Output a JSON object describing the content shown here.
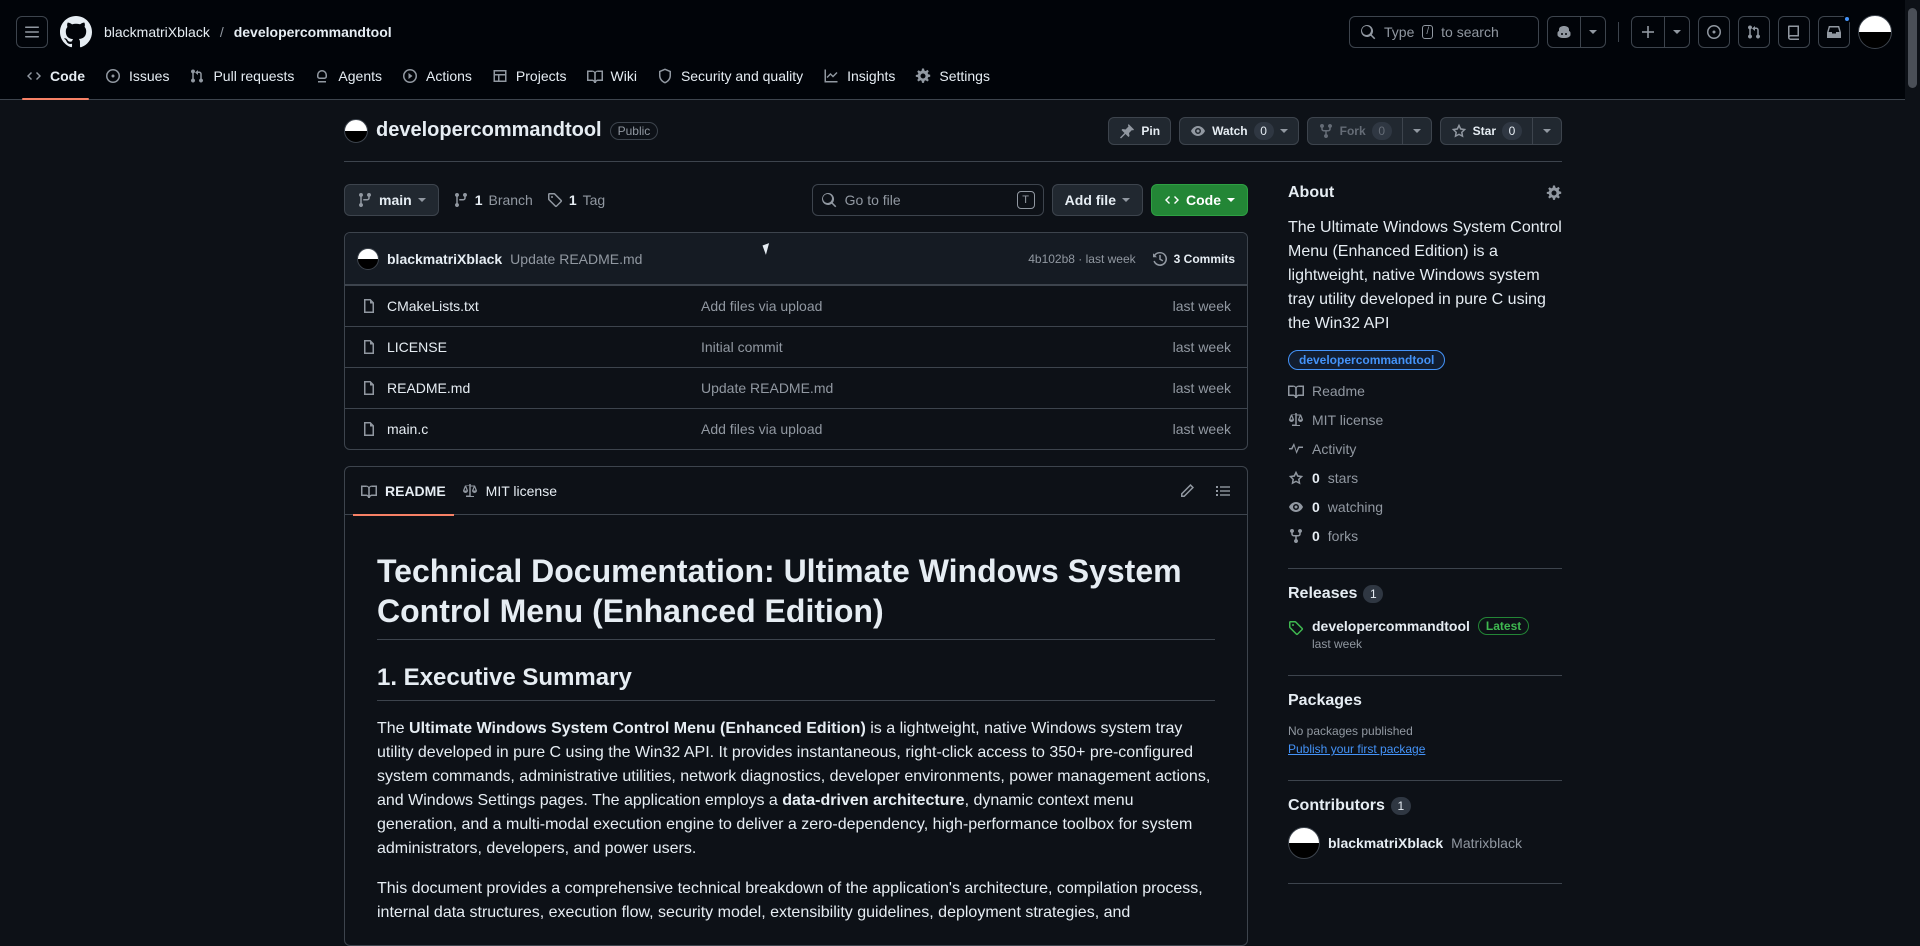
{
  "header": {
    "owner": "blackmatriXblack",
    "separator": "/",
    "repo": "developercommandtool",
    "search_placeholder_a": "Type",
    "search_key": "/",
    "search_placeholder_b": "to search"
  },
  "nav": [
    {
      "label": "Code",
      "icon": "code-icon"
    },
    {
      "label": "Issues",
      "icon": "issue-icon"
    },
    {
      "label": "Pull requests",
      "icon": "pull-request-icon"
    },
    {
      "label": "Agents",
      "icon": "agents-icon"
    },
    {
      "label": "Actions",
      "icon": "play-icon"
    },
    {
      "label": "Projects",
      "icon": "table-icon"
    },
    {
      "label": "Wiki",
      "icon": "book-icon"
    },
    {
      "label": "Security and quality",
      "icon": "shield-icon"
    },
    {
      "label": "Insights",
      "icon": "graph-icon"
    },
    {
      "label": "Settings",
      "icon": "gear-icon"
    }
  ],
  "repo": {
    "name": "developercommandtool",
    "visibility": "Public",
    "pin": "Pin",
    "watch": "Watch",
    "watch_count": "0",
    "fork": "Fork",
    "fork_count": "0",
    "star": "Star",
    "star_count": "0"
  },
  "toolbar": {
    "branch": "main",
    "branches_count": "1",
    "branches_label": "Branch",
    "tags_count": "1",
    "tags_label": "Tag",
    "goto_placeholder": "Go to file",
    "goto_key": "T",
    "add_file": "Add file",
    "code": "Code"
  },
  "commit": {
    "author": "blackmatriXblack",
    "message": "Update README.md",
    "hash_time": "4b102b8 · last week",
    "commits": "3 Commits"
  },
  "files": [
    {
      "name": "CMakeLists.txt",
      "message": "Add files via upload",
      "date": "last week"
    },
    {
      "name": "LICENSE",
      "message": "Initial commit",
      "date": "last week"
    },
    {
      "name": "README.md",
      "message": "Update README.md",
      "date": "last week"
    },
    {
      "name": "main.c",
      "message": "Add files via upload",
      "date": "last week"
    }
  ],
  "readme": {
    "tab_readme": "README",
    "tab_license": "MIT license",
    "h1": "Technical Documentation: Ultimate Windows System Control Menu (Enhanced Edition)",
    "h2": "1. Executive Summary",
    "p1_a": "The ",
    "p1_b": "Ultimate Windows System Control Menu (Enhanced Edition)",
    "p1_c": " is a lightweight, native Windows system tray utility developed in pure C using the Win32 API. It provides instantaneous, right-click access to 350+ pre-configured system commands, administrative utilities, network diagnostics, developer environments, power management actions, and Windows Settings pages. The application employs a ",
    "p1_d": "data-driven architecture",
    "p1_e": ", dynamic context menu generation, and a multi-modal execution engine to deliver a zero-dependency, high-performance toolbox for system administrators, developers, and power users.",
    "p2": "This document provides a comprehensive technical breakdown of the application's architecture, compilation process, internal data structures, execution flow, security model, extensibility guidelines, deployment strategies, and"
  },
  "about": {
    "title": "About",
    "description": "The Ultimate Windows System Control Menu (Enhanced Edition) is a lightweight, native Windows system tray utility developed in pure C using the Win32 API",
    "topic": "developercommandtool",
    "readme": "Readme",
    "license": "MIT license",
    "activity": "Activity",
    "stars_count": "0",
    "stars": "stars",
    "watching_count": "0",
    "watching": "watching",
    "forks_count": "0",
    "forks": "forks"
  },
  "releases": {
    "title": "Releases",
    "count": "1",
    "name": "developercommandtool",
    "badge": "Latest",
    "date": "last week"
  },
  "packages": {
    "title": "Packages",
    "none": "No packages published",
    "publish": "Publish your first package"
  },
  "contributors": {
    "title": "Contributors",
    "count": "1",
    "login": "blackmatriXblack",
    "name": "Matrixblack"
  },
  "colors": {
    "accent": "#f78166",
    "green": "#238636",
    "link": "#4493f8"
  }
}
